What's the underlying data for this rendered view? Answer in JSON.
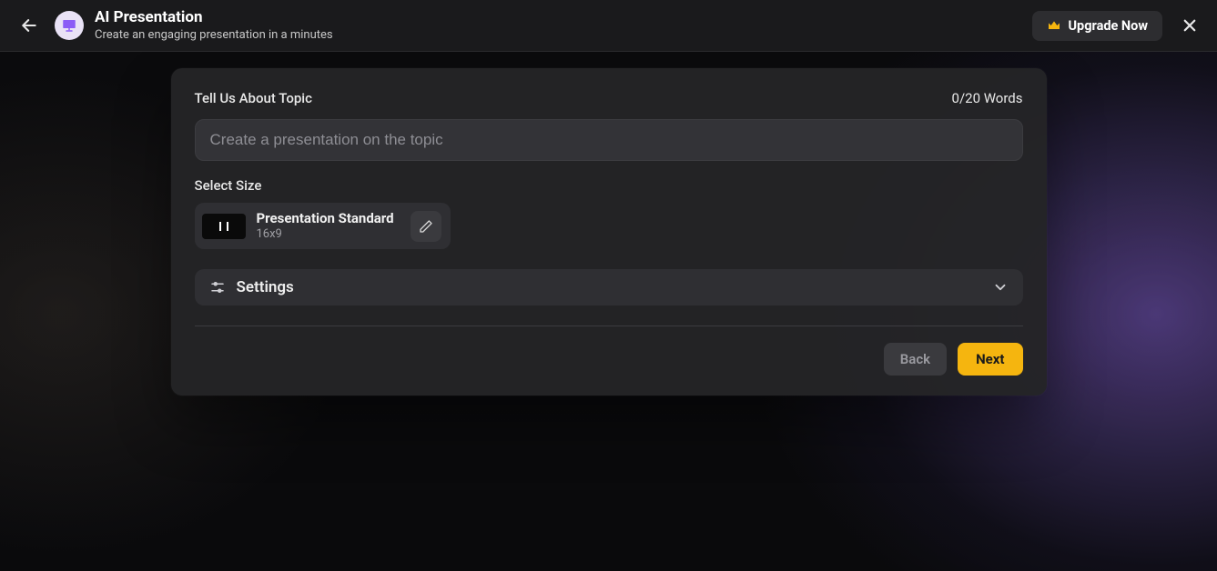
{
  "header": {
    "title": "AI Presentation",
    "subtitle": "Create an engaging presentation in a minutes",
    "upgrade_label": "Upgrade Now"
  },
  "topic": {
    "label": "Tell Us About Topic",
    "word_count": "0/20 Words",
    "placeholder": "Create a presentation on the topic"
  },
  "size": {
    "label": "Select Size",
    "preset_title": "Presentation Standard",
    "preset_ratio": "16x9"
  },
  "settings": {
    "label": "Settings"
  },
  "footer": {
    "back_label": "Back",
    "next_label": "Next"
  }
}
